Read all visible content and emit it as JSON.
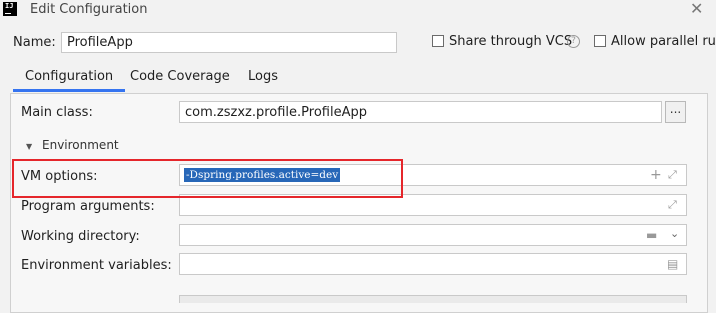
{
  "window": {
    "title": "Edit Configuration",
    "app_icon_text": "IJ",
    "close_icon": "close-icon"
  },
  "header": {
    "name_label": "Name:",
    "name_value": "ProfileApp",
    "share_vcs_label": "Share through VCS",
    "share_vcs_checked": false,
    "help_icon_text": "?",
    "allow_parallel_label": "Allow parallel run",
    "allow_parallel_checked": false
  },
  "tabs": [
    {
      "label": "Configuration",
      "active": true
    },
    {
      "label": "Code Coverage",
      "active": false
    },
    {
      "label": "Logs",
      "active": false
    }
  ],
  "form": {
    "main_class_label": "Main class:",
    "main_class_value": "com.zszxz.profile.ProfileApp",
    "browse_button_label": "...",
    "environment_label": "Environment",
    "environment_expanded": true,
    "vm_options_label": "VM options:",
    "vm_options_value": "-Dspring.profiles.active=dev",
    "program_arguments_label": "Program arguments:",
    "program_arguments_value": "",
    "working_directory_label": "Working directory:",
    "working_directory_value": "",
    "environment_variables_label": "Environment variables:",
    "environment_variables_value": ""
  },
  "annotation": {
    "color": "#e5262b"
  },
  "colors": {
    "accent": "#3574f0",
    "selection": "#2767b8"
  }
}
